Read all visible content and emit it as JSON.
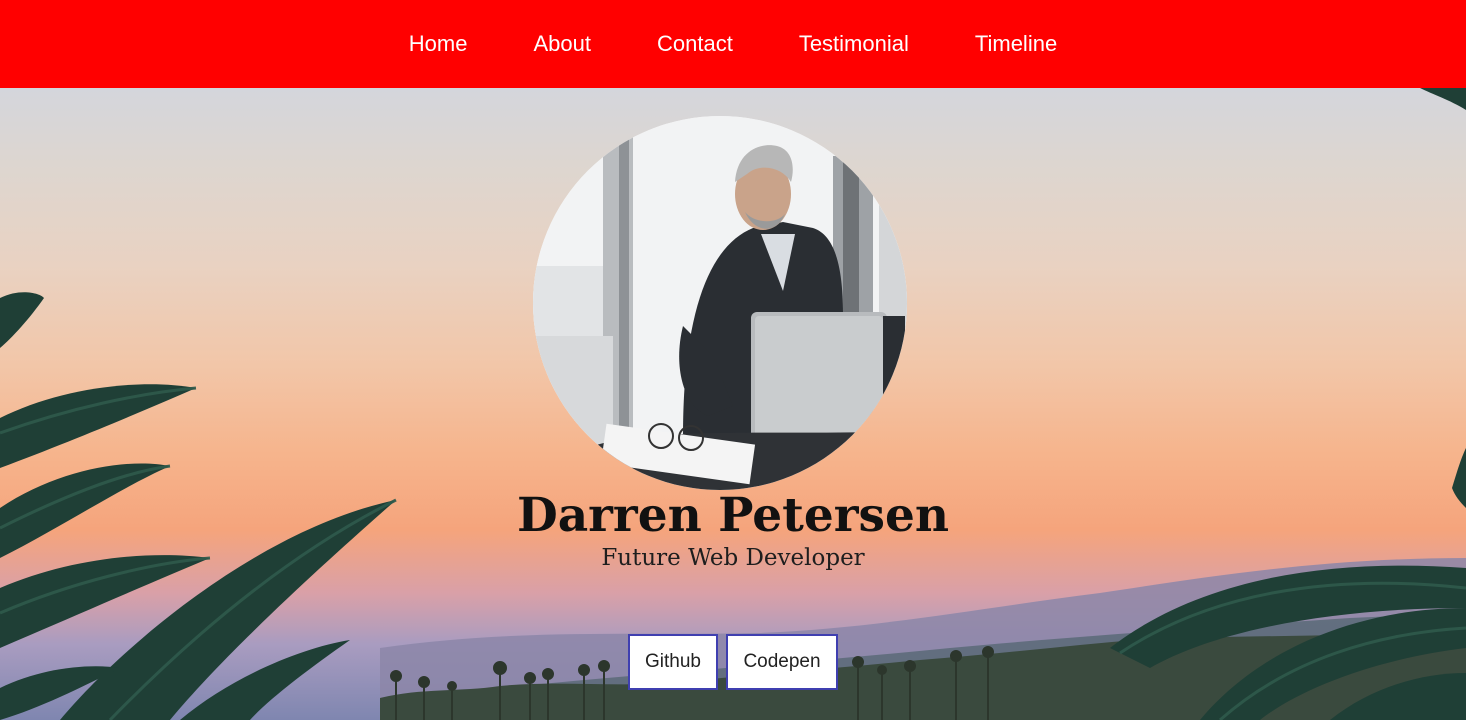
{
  "nav": {
    "items": [
      {
        "label": "Home"
      },
      {
        "label": "About"
      },
      {
        "label": "Contact"
      },
      {
        "label": "Testimonial"
      },
      {
        "label": "Timeline"
      }
    ]
  },
  "hero": {
    "name": "Darren Petersen",
    "subtitle": "Future Web Developer",
    "buttons": {
      "github": "Github",
      "codepen": "Codepen"
    }
  },
  "colors": {
    "navbar": "#ff0000",
    "button_border": "#3f3fb0"
  }
}
